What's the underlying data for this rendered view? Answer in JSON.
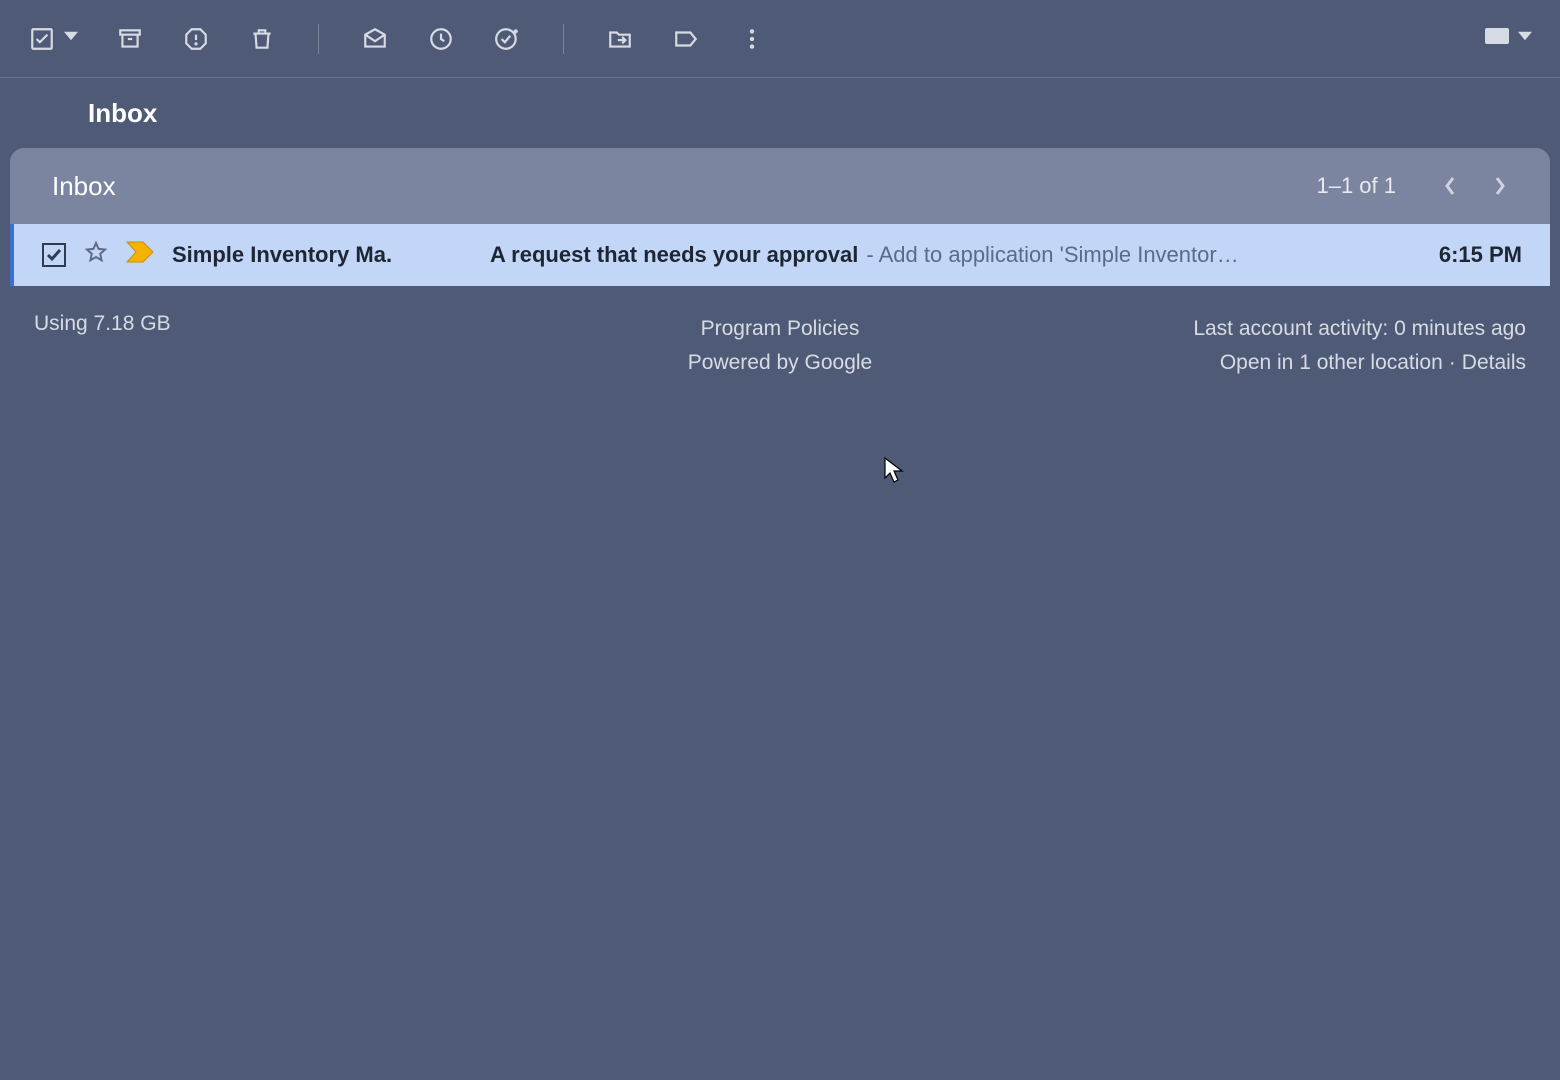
{
  "tabs": {
    "inbox_label": "Inbox"
  },
  "list": {
    "header_title": "Inbox",
    "pager_text": "1–1 of 1"
  },
  "emails": [
    {
      "sender": "Simple Inventory Ma.",
      "subject": "A request that needs your approval",
      "preview_prefix": " - ",
      "preview": "Add to application 'Simple Inventor…",
      "time": "6:15 PM",
      "checked": true,
      "important": true
    }
  ],
  "footer": {
    "storage": "Using 7.18 GB",
    "policies": "Program Policies",
    "powered": "Powered by Google",
    "activity": "Last account activity: 0 minutes ago",
    "open_elsewhere": "Open in 1 other location",
    "details": "Details"
  }
}
